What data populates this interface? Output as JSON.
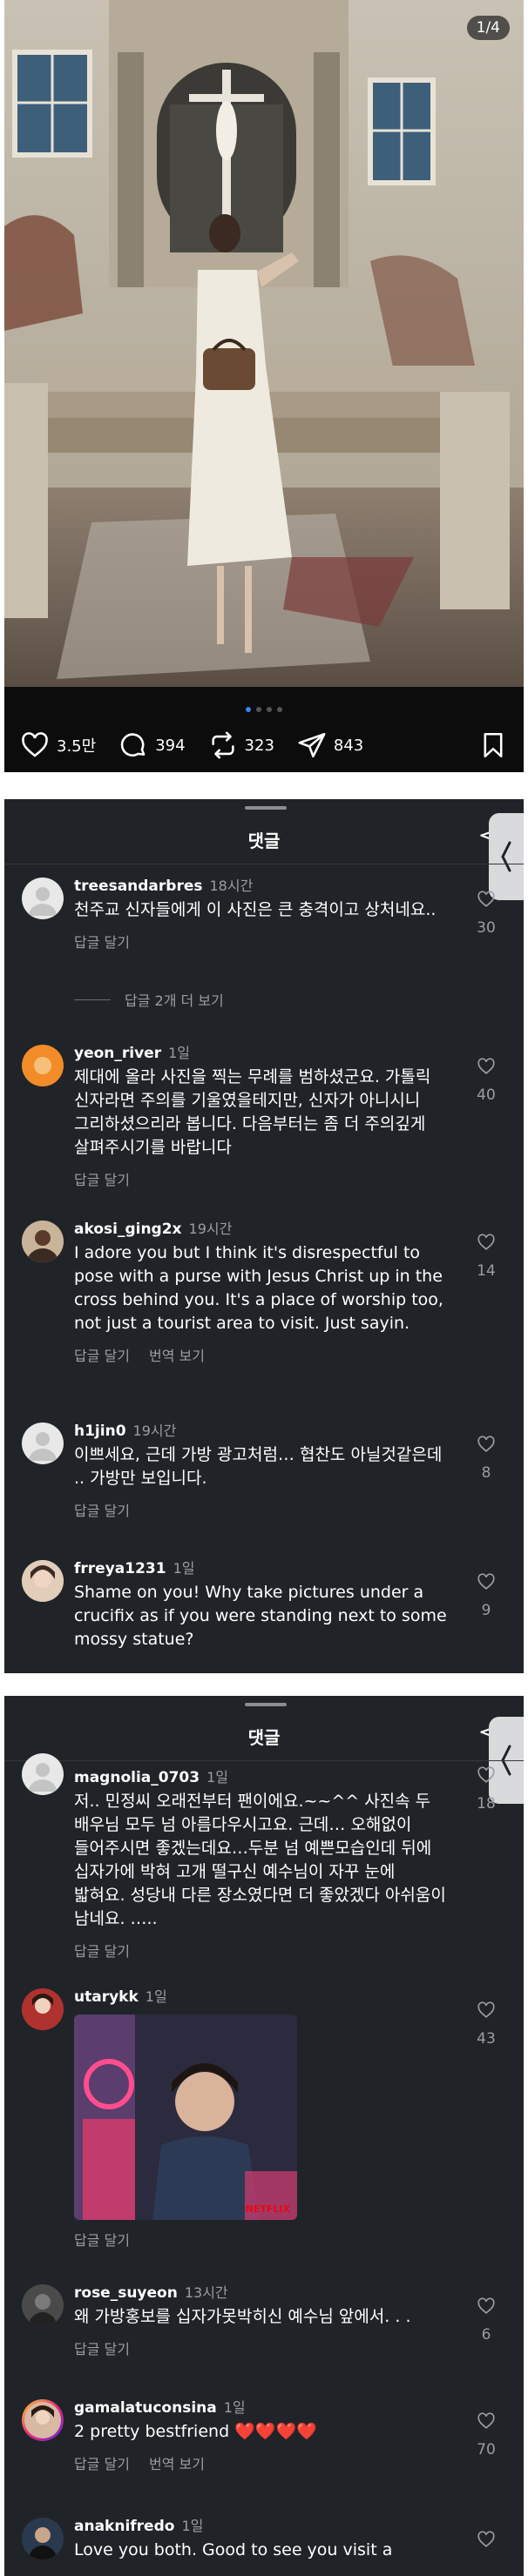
{
  "post": {
    "image_counter": "1/4",
    "likes": "3.5만",
    "comments": "394",
    "reposts": "323",
    "shares": "843",
    "page_dots": 4,
    "active_dot": 1
  },
  "sheet1": {
    "title": "댓글",
    "comments": [
      {
        "username": "treesandarbres",
        "time": "18시간",
        "text": "천주교 신자들에게 이 사진은 큰 충격이고 상처네요..",
        "reply_label": "답글 달기",
        "translate_label": "",
        "likes": "30",
        "more_replies": "답글 2개 더 보기"
      },
      {
        "username": "yeon_river",
        "time": "1일",
        "text": "제대에 올라 사진을 찍는 무례를 범하셨군요. 가톨릭 신자라면 주의를 기울였을테지만, 신자가 아니시니 그리하셨으리라 봅니다. 다음부터는 좀 더 주의깊게 살펴주시기를 바랍니다",
        "reply_label": "답글 달기",
        "translate_label": "",
        "likes": "40"
      },
      {
        "username": "akosi_ging2x",
        "time": "19시간",
        "text": "I adore you but I think it's disrespectful to pose with a purse with Jesus Christ up in the cross behind you. It's a place of worship too, not just a tourist area to visit. Just sayin.",
        "reply_label": "답글 달기",
        "translate_label": "번역 보기",
        "likes": "14"
      },
      {
        "username": "h1jin0",
        "time": "19시간",
        "text": "이쁘세요, 근데 가방 광고처럼… 협찬도 아닐것같은데 .. 가방만 보입니다.",
        "reply_label": "답글 달기",
        "translate_label": "",
        "likes": "8"
      },
      {
        "username": "frreya1231",
        "time": "1일",
        "text": "Shame on you! Why take pictures under a crucifix as if you were standing next to some mossy statue?",
        "reply_label": "",
        "translate_label": "",
        "likes": "9"
      }
    ]
  },
  "sheet2": {
    "title": "댓글",
    "comments": [
      {
        "username": "magnolia_0703",
        "time": "1일",
        "text": "저.. 민정씨 오래전부터 팬이에요.~~^^ 사진속 두 배우님 모두 넘 아름다우시고요. 근데… 오해없이 들어주시면 좋겠는데요…두분 넘 예쁜모습인데 뒤에 십자가에 박혀 고개 떨구신 예수님이 자꾸 눈에 밟혀요. 성당내 다른 장소였다면 더 좋았겠다 아쉬움이 남네요. …..",
        "reply_label": "답글 달기",
        "translate_label": "",
        "likes": "18"
      },
      {
        "username": "utarykk",
        "time": "1일",
        "text": "",
        "reply_label": "답글 달기",
        "translate_label": "",
        "likes": "43",
        "gif_badge": "NETFLIX"
      },
      {
        "username": "rose_suyeon",
        "time": "13시간",
        "text": "왜 가방홍보를 십자가못박히신 예수님 앞에서. . .",
        "reply_label": "답글 달기",
        "translate_label": "",
        "likes": "6"
      },
      {
        "username": "gamalatuconsina",
        "time": "1일",
        "text": "2 pretty bestfriend ❤️❤️❤️❤️",
        "reply_label": "답글 달기",
        "translate_label": "번역 보기",
        "likes": "70"
      },
      {
        "username": "anaknifredo",
        "time": "1일",
        "text": "Love you both. Good to see you visit a",
        "reply_label": "",
        "translate_label": "",
        "likes": ""
      }
    ]
  },
  "colors": {
    "sheet_bg": "#202428",
    "accent_dot": "#3b82f6",
    "heart_red": "#e0245e"
  }
}
